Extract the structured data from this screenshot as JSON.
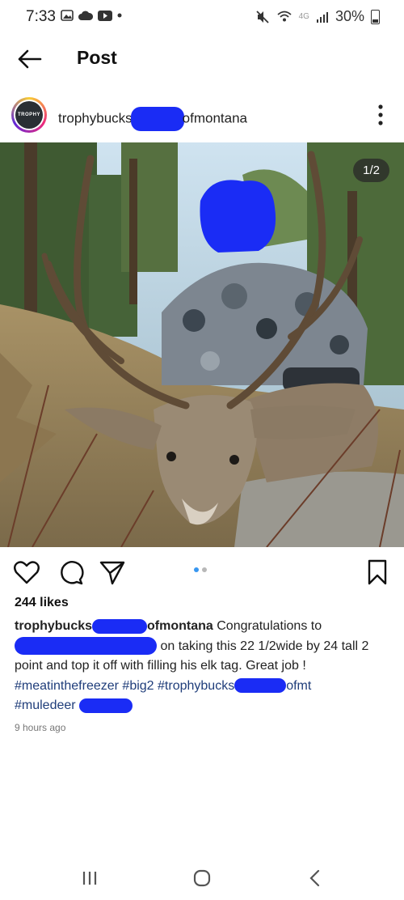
{
  "status": {
    "time": "7:33",
    "network": "4G",
    "battery": "30%"
  },
  "header": {
    "title": "Post"
  },
  "post": {
    "username_start": "trophybucks",
    "username_end": "ofmontana",
    "image_counter": "1/2",
    "likes": "244 likes",
    "caption": {
      "user_start": "trophybucks",
      "user_end": "ofmontana",
      "part1": " Congratulations to",
      "part2": " on taking this 22 1/2wide by 24 tall 2 point and top it off with filling his elk tag. Great job !",
      "tag1": "#meatinthefreezer",
      "tag2": "#big2",
      "tag3_start": "#trophybucks",
      "tag3_end": "ofmt",
      "tag4": "#muledeer"
    },
    "time_ago": "9 hours ago"
  },
  "colors": {
    "tag": "#1f3d7a",
    "redaction": "#1a2cf5",
    "dot_active": "#3897f0"
  }
}
